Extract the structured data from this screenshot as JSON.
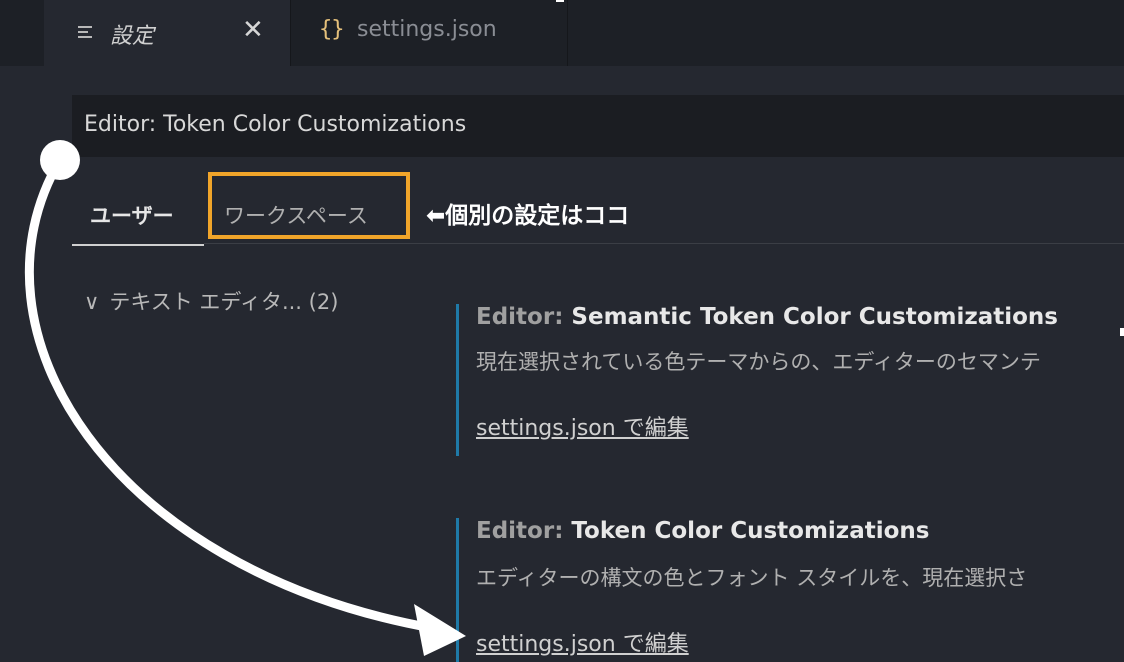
{
  "tabs": {
    "settings_label": "設定",
    "close_glyph": "✕",
    "json_icon": "{}",
    "json_label": "settings.json"
  },
  "search": {
    "value": "Editor: Token Color Customizations"
  },
  "scope_tabs": {
    "user_label": "ユーザー",
    "workspace_label": "ワークスペース"
  },
  "annotation": {
    "text": "⬅個別の設定はココ",
    "highlight_color": "#f1a52a"
  },
  "toc": {
    "chevron": "∨",
    "item_label": "テキスト エディタ... (2)"
  },
  "settings": [
    {
      "category": "Editor: ",
      "name": "Semantic Token Color Customizations",
      "description": "現在選択されている色テーマからの、エディターのセマンテ",
      "link": "settings.json で編集"
    },
    {
      "category": "Editor: ",
      "name": "Token Color Customizations",
      "description": "エディターの構文の色とフォント スタイルを、現在選択さ",
      "link": "settings.json で編集"
    }
  ],
  "colors": {
    "accent_bar": "#1f7aa8",
    "json_icon": "#e5c07b",
    "arrow": "#ffffff"
  }
}
